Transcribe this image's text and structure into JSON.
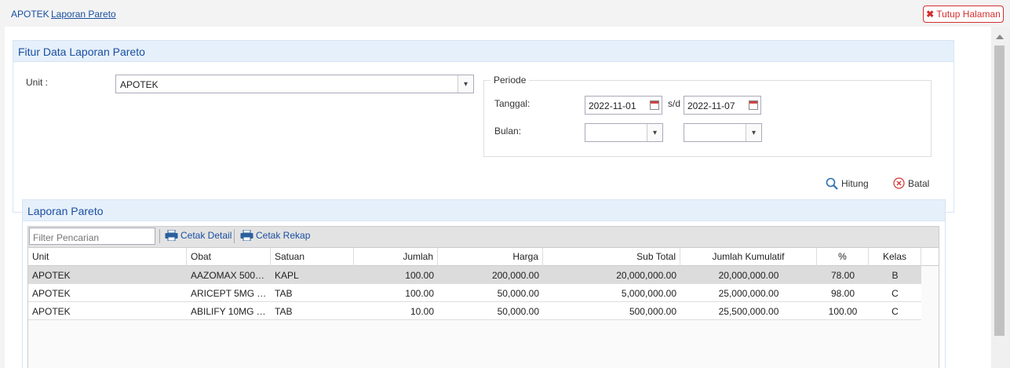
{
  "breadcrumb": {
    "root": "APOTEK",
    "current": "Laporan Pareto"
  },
  "close_button": {
    "label": "Tutup Halaman"
  },
  "filter_panel": {
    "title": "Fitur Data Laporan Pareto",
    "unit_label": "Unit :",
    "unit_value": "APOTEK",
    "periode": {
      "legend": "Periode",
      "tanggal_label": "Tanggal:",
      "date_from": "2022-11-01",
      "sd_label": "s/d",
      "date_to": "2022-11-07",
      "bulan_label": "Bulan:"
    },
    "hitung_label": "Hitung",
    "batal_label": "Batal"
  },
  "report_panel": {
    "title": "Laporan Pareto",
    "filter_placeholder": "Filter Pencarian",
    "cetak_detail": "Cetak Detail",
    "cetak_rekap": "Cetak Rekap",
    "columns": [
      "Unit",
      "Obat",
      "Satuan",
      "Jumlah",
      "Harga",
      "Sub Total",
      "Jumlah Kumulatif",
      "%",
      "Kelas"
    ],
    "rows": [
      [
        "APOTEK",
        "AAZOMAX 500M...",
        "KAPL",
        "100.00",
        "200,000.00",
        "20,000,000.00",
        "20,000,000.00",
        "78.00",
        "B"
      ],
      [
        "APOTEK",
        "ARICEPT 5MG TA...",
        "TAB",
        "100.00",
        "50,000.00",
        "5,000,000.00",
        "25,000,000.00",
        "98.00",
        "C"
      ],
      [
        "APOTEK",
        "ABILIFY 10MG T...",
        "TAB",
        "10.00",
        "50,000.00",
        "500,000.00",
        "25,500,000.00",
        "100.00",
        "C"
      ]
    ]
  },
  "colors": {
    "accent": "#1a4fa0",
    "danger": "#d32f2f",
    "panel_header_bg": "#e6f0fb"
  }
}
